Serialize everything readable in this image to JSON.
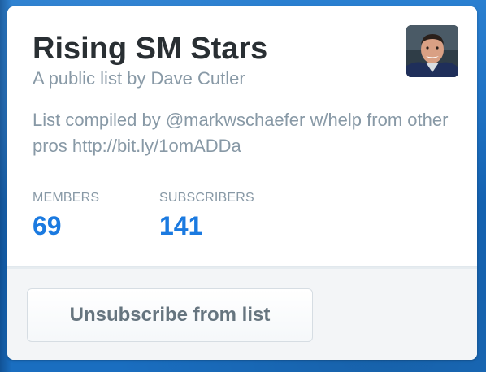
{
  "list": {
    "title": "Rising SM Stars",
    "owner_line": "A public list by Dave Cutler",
    "description": "List compiled by @markwschaefer w/help from other pros http://bit.ly/1omADDa"
  },
  "stats": {
    "members_label": "MEMBERS",
    "members_value": "69",
    "subscribers_label": "SUBSCRIBERS",
    "subscribers_value": "141"
  },
  "actions": {
    "unsubscribe_label": "Unsubscribe from list"
  },
  "icons": {
    "avatar": "owner-avatar-photo"
  },
  "colors": {
    "stat_value": "#1b7ae0",
    "muted_text": "#8899a6",
    "title_text": "#292f33",
    "page_background": "#1b6fc2"
  }
}
